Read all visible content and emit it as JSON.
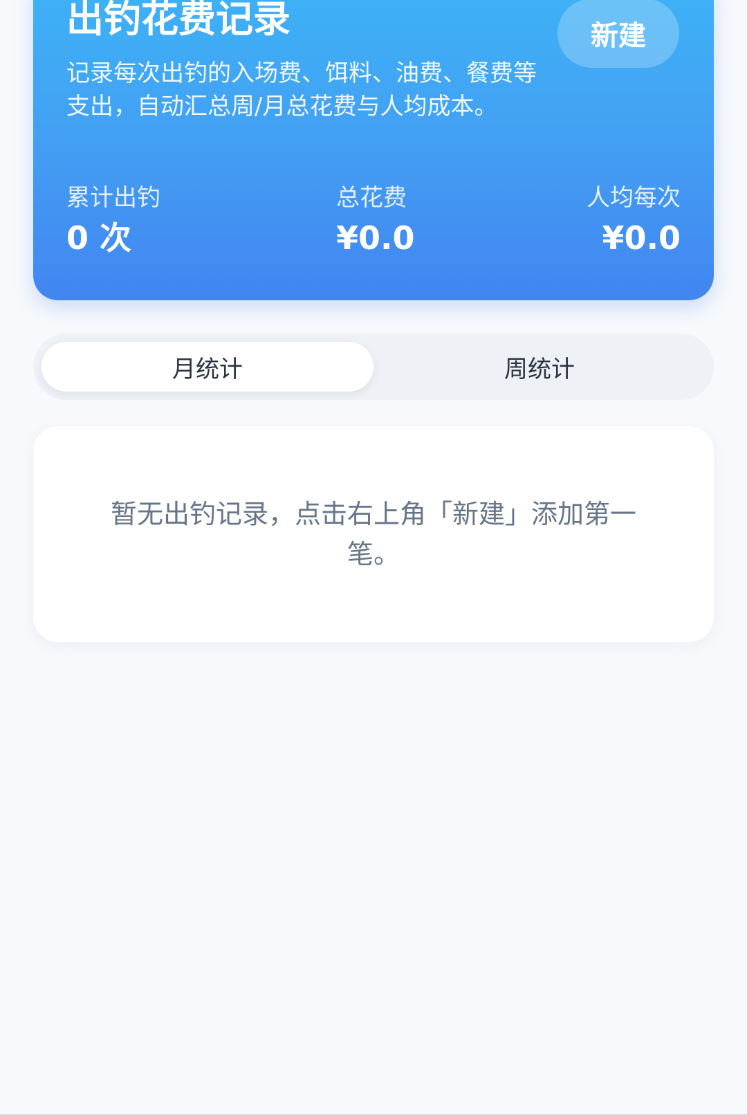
{
  "header": {
    "title": "出钓花费记录",
    "new_button": "新建",
    "description": "记录每次出钓的入场费、饵料、油费、餐费等支出，自动汇总周/月总花费与人均成本。"
  },
  "stats": [
    {
      "label": "累计出钓",
      "value": "0 次"
    },
    {
      "label": "总花费",
      "value": "¥0.0"
    },
    {
      "label": "人均每次",
      "value": "¥0.0"
    }
  ],
  "tabs": {
    "month": "月统计",
    "week": "周统计",
    "active": "month"
  },
  "empty_state": {
    "text": "暂无出钓记录，点击右上角「新建」添加第一笔。"
  },
  "colors": {
    "gradient_top": "#3DB2F7",
    "gradient_bottom": "#4285F1",
    "page_background": "#F7F9FC",
    "muted_text": "#66758A"
  }
}
